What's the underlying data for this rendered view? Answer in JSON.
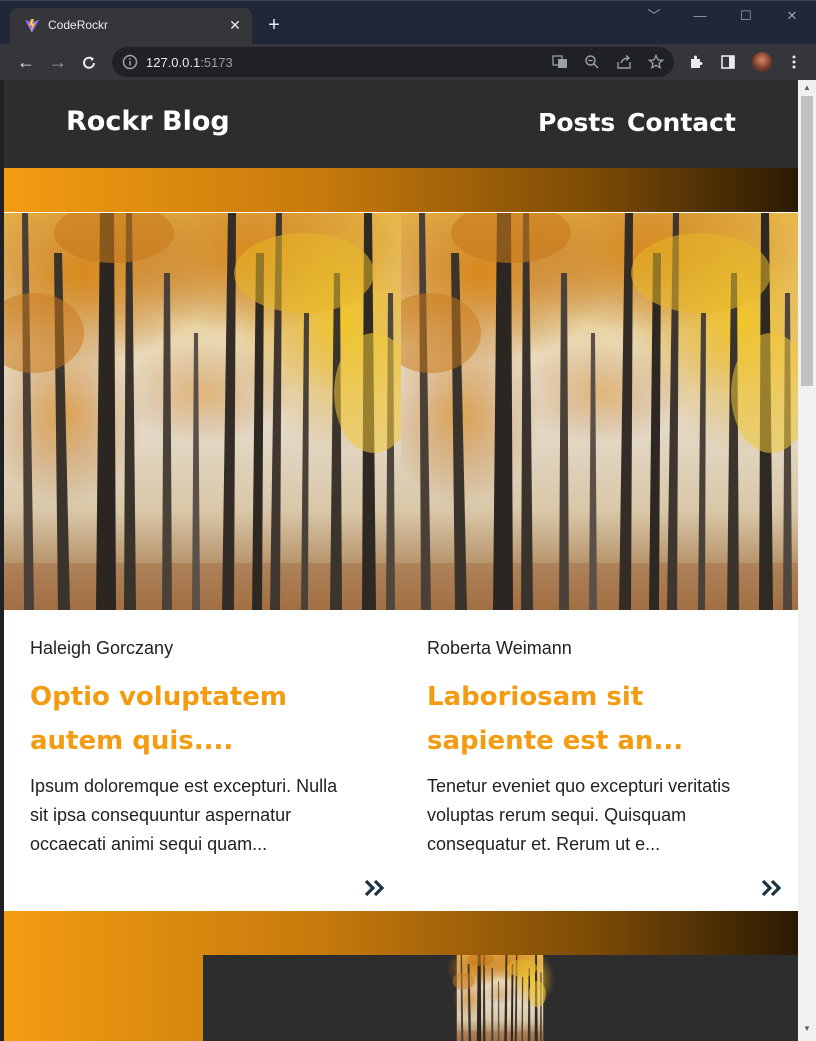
{
  "browser": {
    "tab_title": "CodeRockr",
    "tab_close": "✕",
    "new_tab": "+",
    "url_host": "127.0.0.1",
    "url_port": ":5173",
    "window_controls": [
      "﹀",
      "—",
      "☐",
      "✕"
    ],
    "nav": {
      "back": "←",
      "forward": "→"
    },
    "icons": [
      "translate-icon",
      "zoom-icon",
      "share-icon",
      "bookmark-star-icon",
      "extensions-icon",
      "side-panel-icon",
      "profile-avatar",
      "menu-kebab-icon"
    ]
  },
  "site": {
    "brand": "Rockr Blog",
    "nav": {
      "posts": "Posts",
      "contact": "Contact"
    },
    "colors": {
      "header_bg": "#2d2d2d",
      "accent": "#f39c12",
      "arrow": "#1c3441"
    }
  },
  "posts": [
    {
      "author": "Haleigh Gorczany",
      "title": "Optio voluptatem autem quis....",
      "excerpt": "Ipsum doloremque est excepturi. Nulla sit ipsa consequuntur aspernatur occaecati animi sequi quam..."
    },
    {
      "author": "Roberta Weimann",
      "title": "Laboriosam sit sapiente est an...",
      "excerpt": "Tenetur eveniet quo excepturi veritatis voluptas rerum sequi. Quisquam consequatur et. Rerum ut e..."
    }
  ]
}
